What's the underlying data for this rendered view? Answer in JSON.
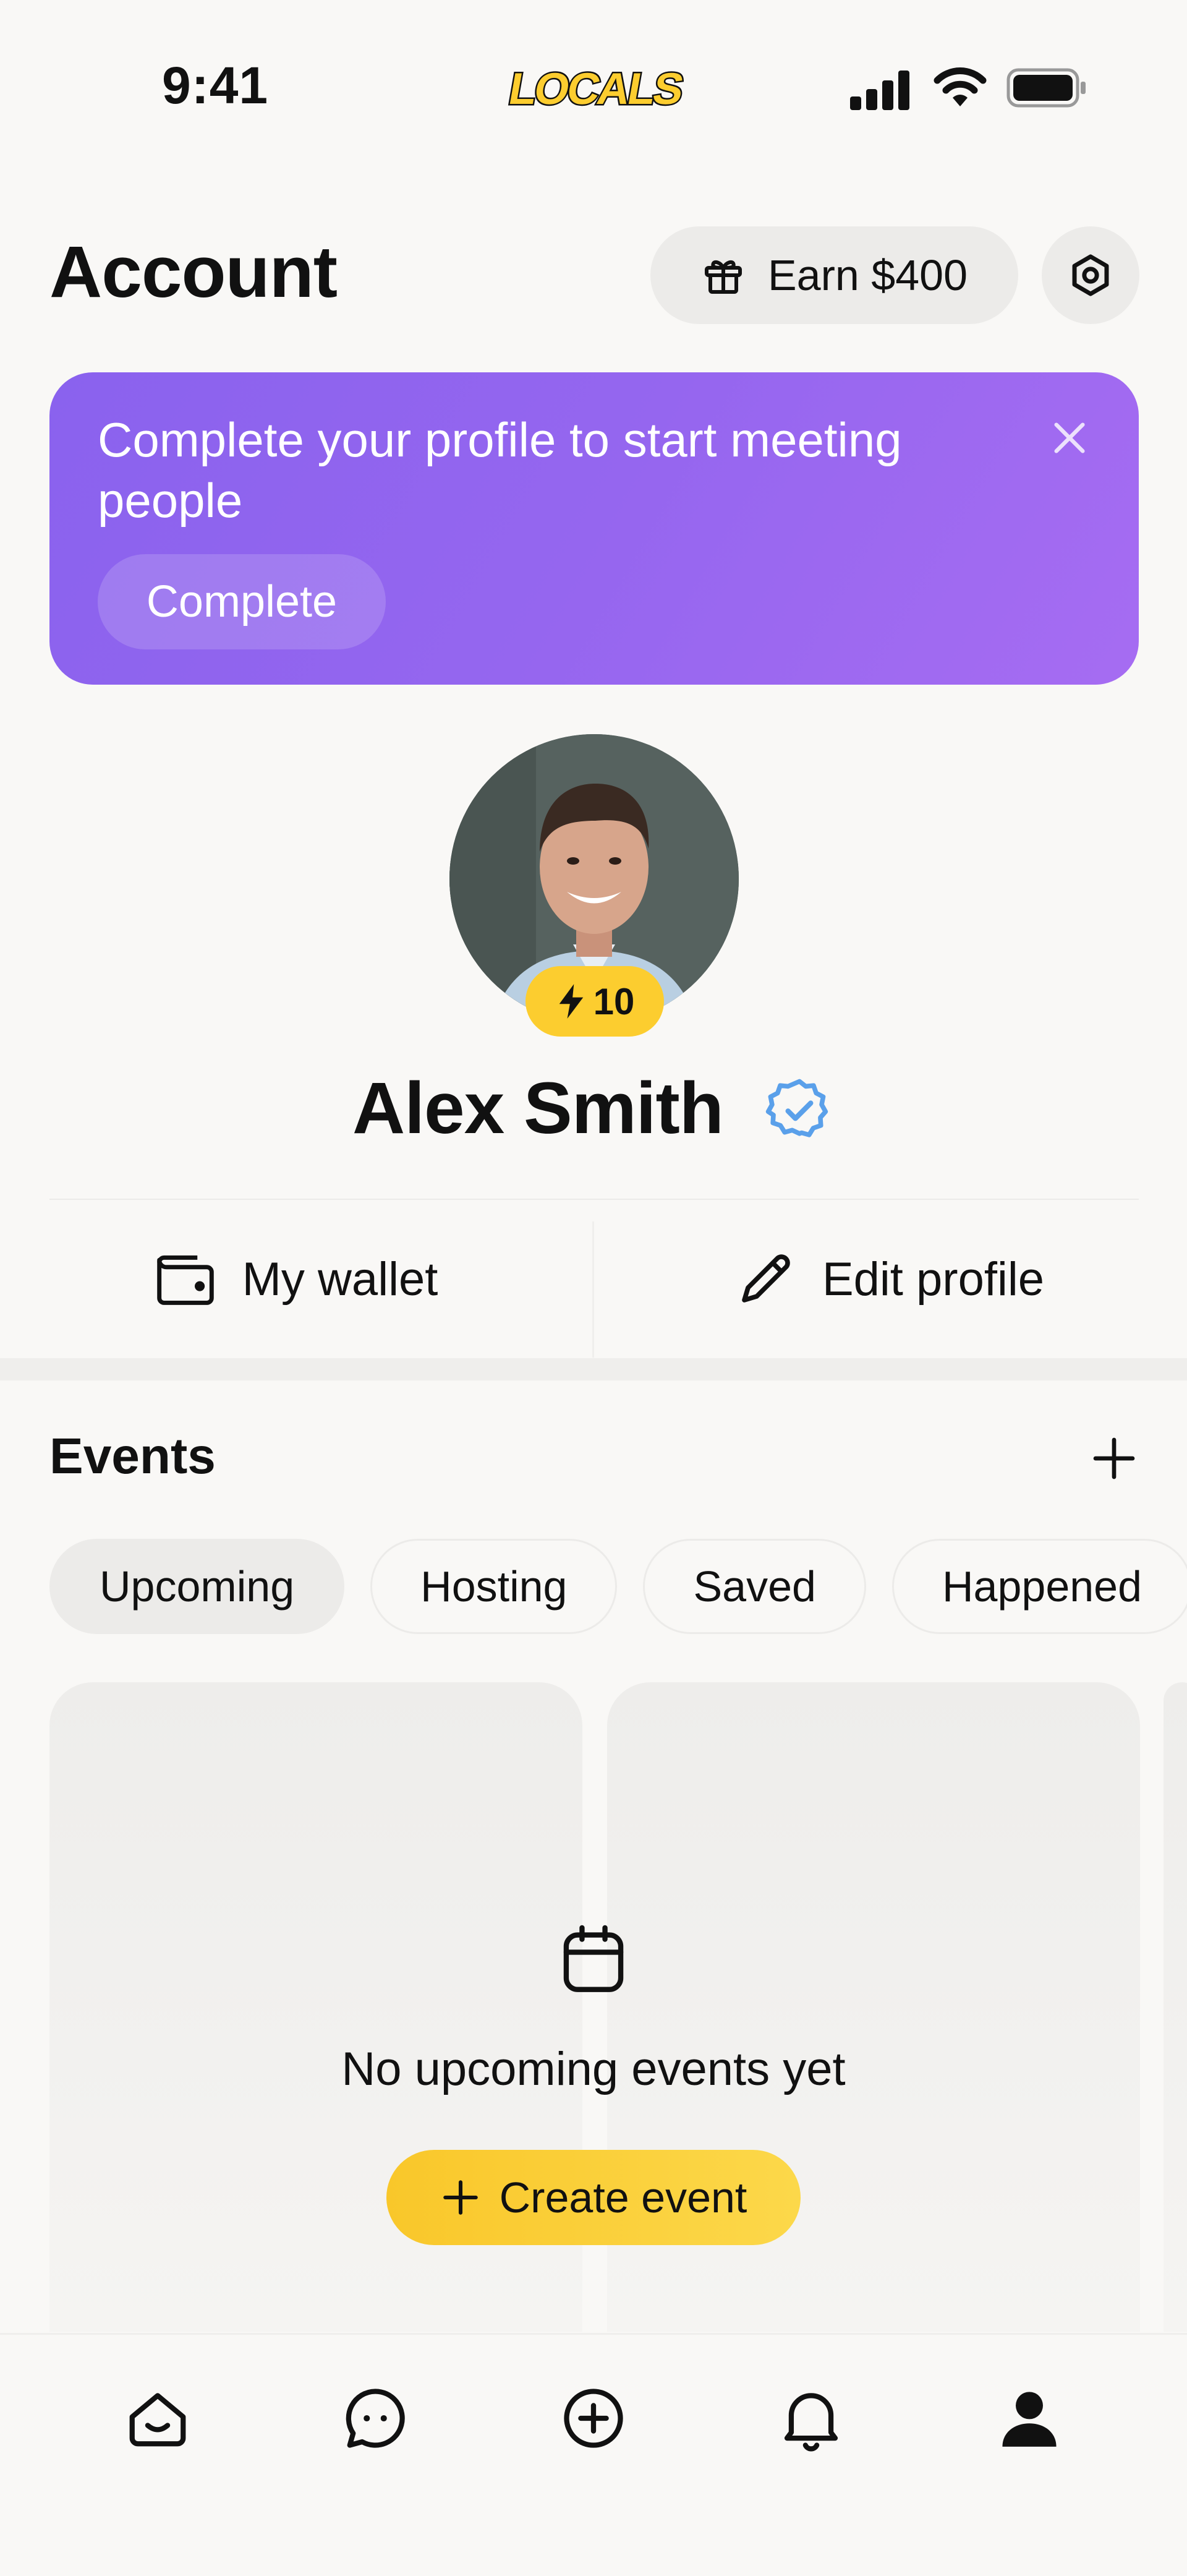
{
  "status_bar": {
    "time": "9:41",
    "logo_text": "LOCALS"
  },
  "header": {
    "title": "Account",
    "earn_label": "Earn $400"
  },
  "banner": {
    "message": "Complete your profile to start meeting people",
    "button_label": "Complete"
  },
  "profile": {
    "name": "Alex Smith",
    "badge_value": "10",
    "verified": true
  },
  "actions": {
    "wallet_label": "My wallet",
    "edit_label": "Edit profile"
  },
  "events": {
    "title": "Events",
    "tabs": [
      {
        "label": "Upcoming",
        "active": true
      },
      {
        "label": "Hosting",
        "active": false
      },
      {
        "label": "Saved",
        "active": false
      },
      {
        "label": "Happened",
        "active": false
      }
    ],
    "empty_text": "No upcoming events yet",
    "create_label": "Create event"
  },
  "nav": {
    "items": [
      "home-icon",
      "chat-icon",
      "add-circle-icon",
      "bell-icon",
      "profile-icon"
    ],
    "active": "profile-icon"
  },
  "colors": {
    "banner": "#9566ef",
    "accent_yellow": "#fccd2f",
    "verified_blue": "#5aa0ea"
  }
}
